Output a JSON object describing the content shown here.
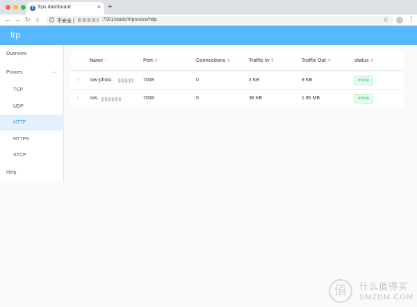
{
  "browser": {
    "tab_title": "frps dashboard",
    "tab_close": "×",
    "new_tab": "+",
    "insecure_label": "不安全 |",
    "url_visible": ":7001/static/#/proxies/http",
    "icons": {
      "back": "back-arrow-icon",
      "forward": "forward-arrow-icon",
      "reload": "reload-icon",
      "home": "home-icon",
      "info": "info-icon",
      "star": "star-icon",
      "profile": "profile-icon",
      "menu": "kebab-menu-icon"
    }
  },
  "app": {
    "brand": "frp",
    "header_color": "#58b7ff"
  },
  "sidebar": {
    "items": [
      {
        "label": "Overview"
      },
      {
        "label": "Proxies",
        "expanded": true
      },
      {
        "label": "TCP"
      },
      {
        "label": "UDP"
      },
      {
        "label": "HTTP",
        "active": true
      },
      {
        "label": "HTTPS"
      },
      {
        "label": "STCP"
      },
      {
        "label": "Help"
      }
    ]
  },
  "table": {
    "columns": [
      "Name",
      "Port",
      "Connections",
      "Traffic In",
      "Traffic Out",
      "status"
    ],
    "sort_glyph": "⇕",
    "name_sort_glyph": "↑",
    "rows": [
      {
        "name": "nas-photo.",
        "port": "7008",
        "connections": "0",
        "traffic_in": "2 KB",
        "traffic_out": "9 KB",
        "status": "online"
      },
      {
        "name": "nas.",
        "port": "7008",
        "connections": "0",
        "traffic_in": "38 KB",
        "traffic_out": "1.86 MB",
        "status": "online"
      }
    ],
    "status_color": "#13ce66"
  },
  "watermark": {
    "glyph": "值",
    "cn": "什么值得买",
    "en": "SMZDM.COM"
  }
}
